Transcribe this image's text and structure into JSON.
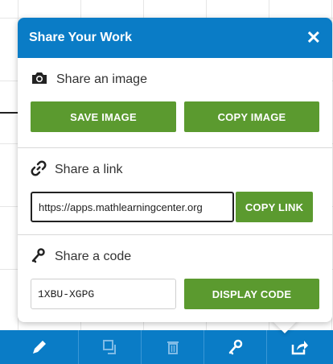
{
  "panel": {
    "title": "Share Your Work",
    "close_label": "✕",
    "image_section": {
      "label": "Share an image",
      "save_label": "SAVE IMAGE",
      "copy_label": "COPY IMAGE"
    },
    "link_section": {
      "label": "Share a link",
      "url": "https://apps.mathlearningcenter.org",
      "copy_label": "COPY LINK"
    },
    "code_section": {
      "label": "Share a code",
      "code": "1XBU-XGPG",
      "display_label": "DISPLAY CODE"
    }
  },
  "toolbar": {
    "items": [
      "pencil-icon",
      "duplicate-icon",
      "trash-icon",
      "key-icon",
      "share-icon"
    ]
  },
  "colors": {
    "brand_blue": "#0a7cc6",
    "button_green": "#5b9a2f"
  }
}
